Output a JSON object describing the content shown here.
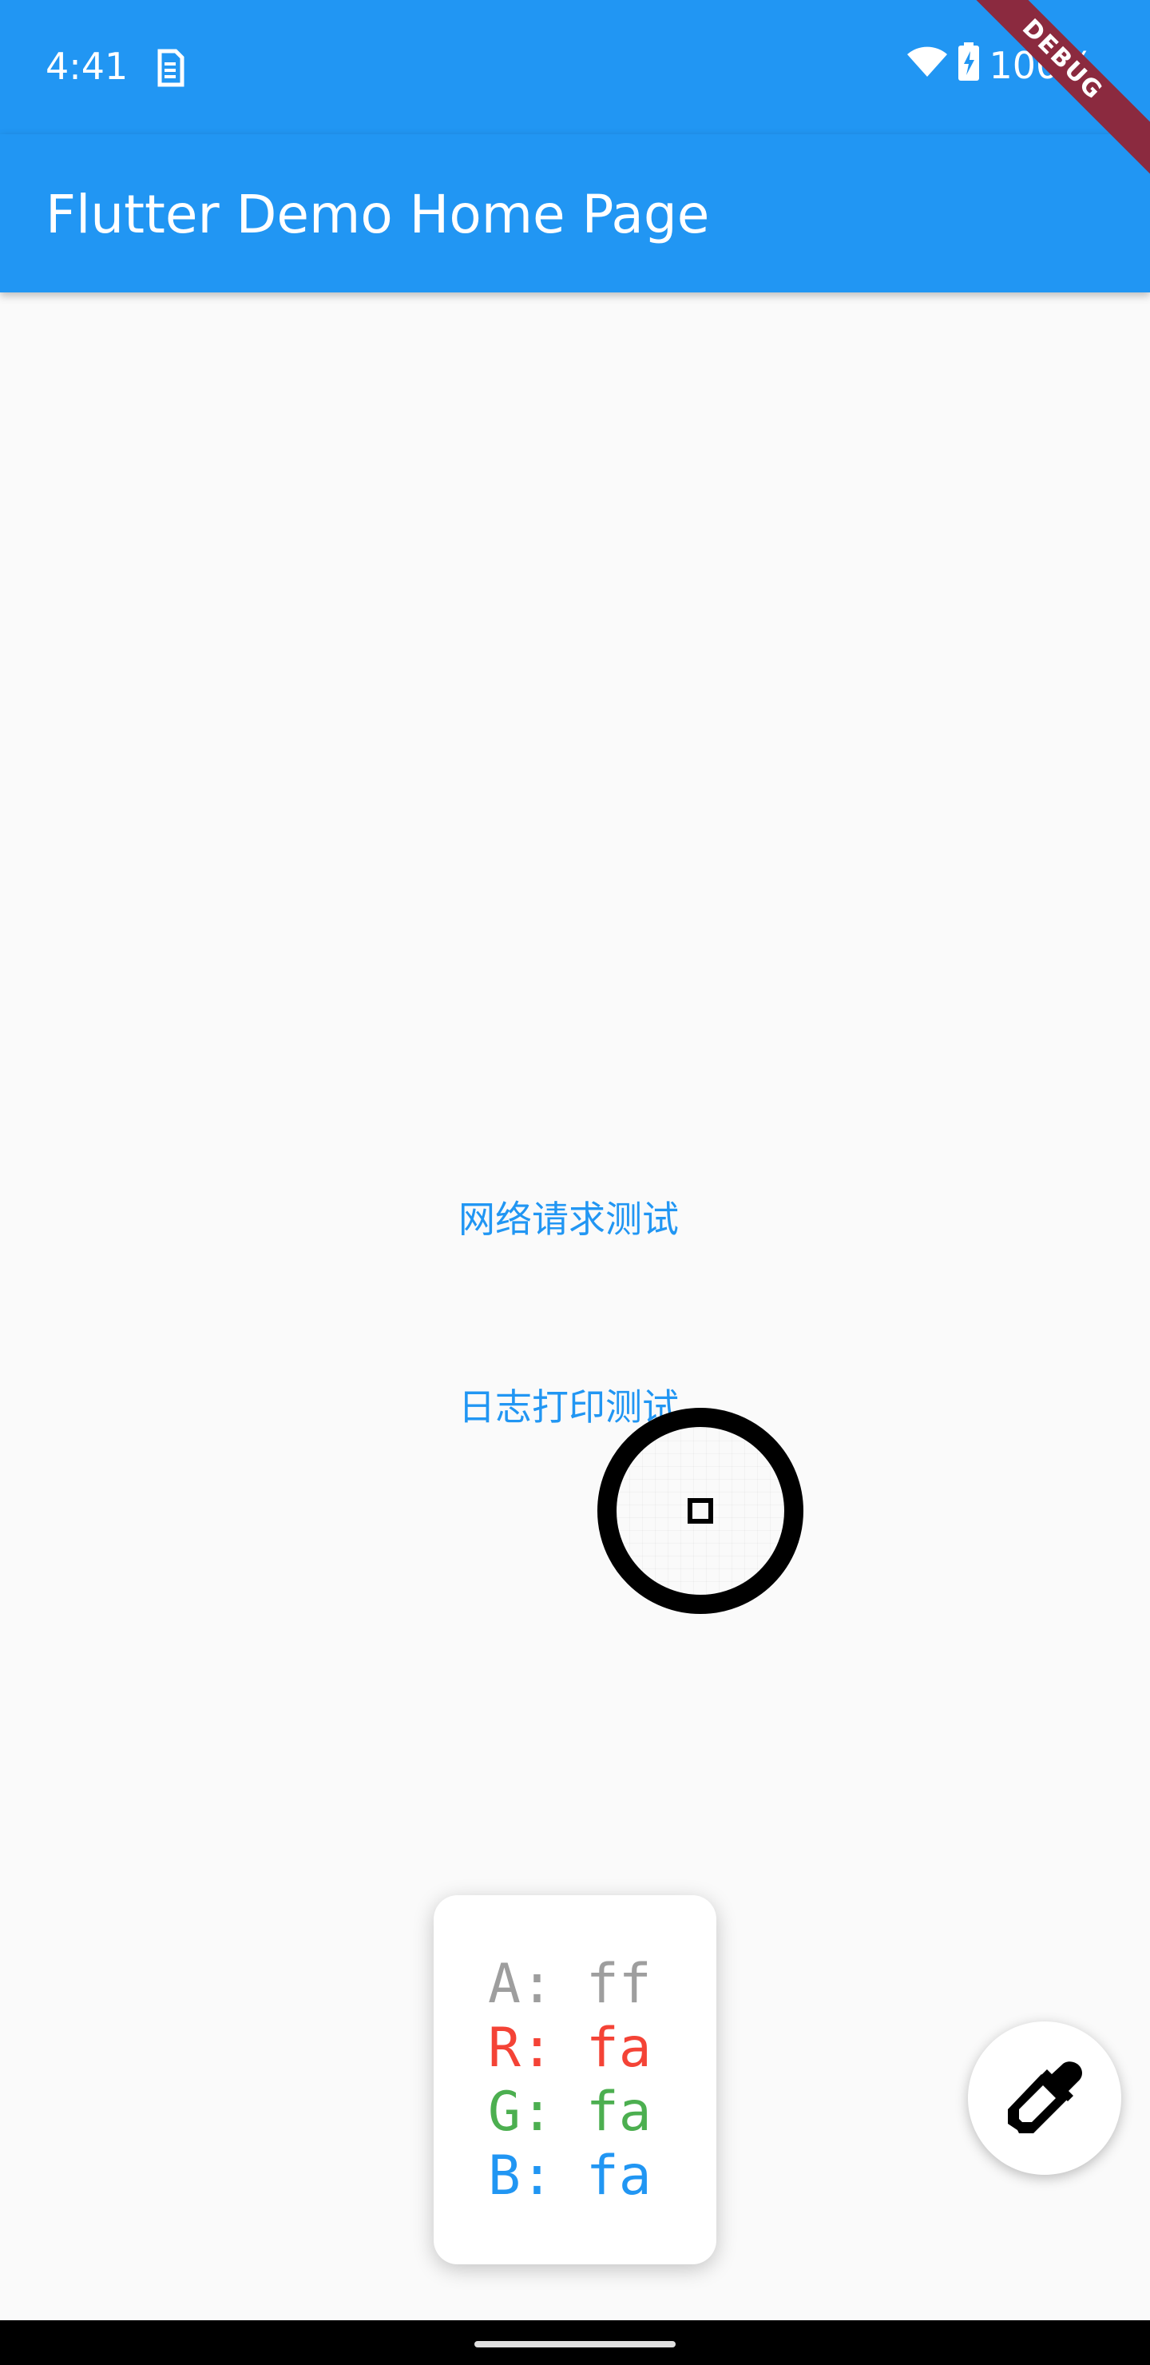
{
  "status_bar": {
    "time": "4:41",
    "battery": "100%",
    "icons": [
      "sim-card-icon",
      "wifi-icon",
      "battery-charging-icon"
    ]
  },
  "app_bar": {
    "title": "Flutter Demo Home Page"
  },
  "debug_banner": "DEBUG",
  "buttons": {
    "network_test": "网络请求测试",
    "log_test": "日志打印测试"
  },
  "color_info": {
    "a": "A: ff",
    "r": "R: fa",
    "g": "G: fa",
    "b": "B: fa"
  },
  "fab": {
    "icon": "color-picker-icon"
  },
  "colors": {
    "primary": "#2196f3",
    "background": "#fafafa",
    "debug_banner": "#8b2a3f",
    "alpha_text": "#9e9e9e",
    "red_text": "#f44336",
    "green_text": "#4caf50",
    "blue_text": "#2196f3"
  }
}
